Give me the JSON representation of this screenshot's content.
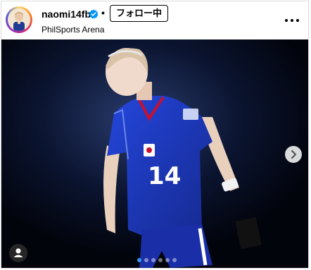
{
  "post": {
    "username": "naomi14fb",
    "separator": "•",
    "follow_label": "フォロー中",
    "location": "PhilSports Arena",
    "verified_icon": "verified-badge-icon",
    "more_icon": "more-horizontal-icon"
  },
  "media": {
    "jersey_number": "14",
    "carousel_total": 6,
    "carousel_active_index": 0,
    "next_icon": "chevron-right-icon",
    "tag_icon": "user-tag-icon"
  },
  "colors": {
    "verified_blue": "#0095f6",
    "jersey_blue": "#1c37c9",
    "dot_active": "#3897f0"
  }
}
